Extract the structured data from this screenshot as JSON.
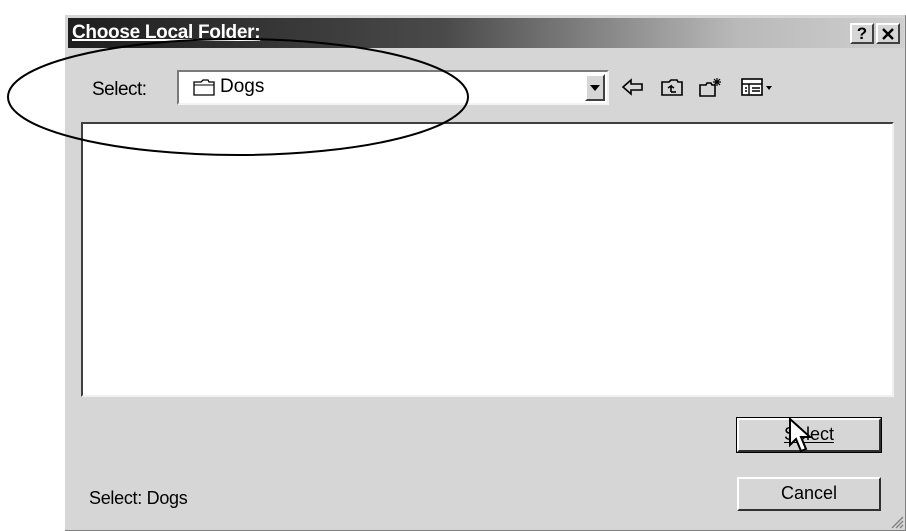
{
  "dialog": {
    "title": "Choose Local Folder:",
    "help_label": "?",
    "close_label": "✕"
  },
  "select": {
    "label": "Select:",
    "value": "Dogs",
    "icon": "folder-icon"
  },
  "toolbar": {
    "icons": [
      "back-arrow-icon",
      "up-one-level-icon",
      "new-folder-icon",
      "view-menu-icon"
    ]
  },
  "status": {
    "text": "Select: Dogs"
  },
  "buttons": {
    "select_label": "Select",
    "cancel_label": "Cancel"
  },
  "colors": {
    "dialog_face": "#d6d6d6",
    "title_start": "#1e1e1e"
  }
}
